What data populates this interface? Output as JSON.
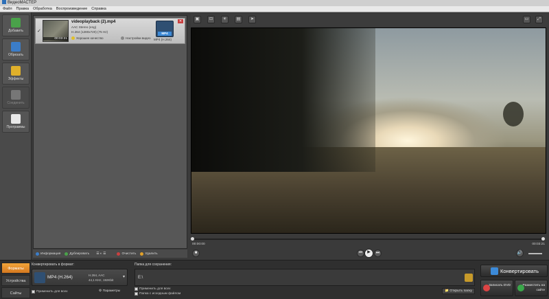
{
  "titlebar": {
    "title": "ВидеоМАСТЕР"
  },
  "menu": {
    "items": [
      "Файл",
      "Правка",
      "Обработка",
      "Воспроизведение",
      "Справка"
    ]
  },
  "leftbar": {
    "items": [
      {
        "label": "Добавить",
        "color": "#4aa24a"
      },
      {
        "label": "Обрезать",
        "color": "#3b7dc9"
      },
      {
        "label": "Эффекты",
        "color": "#e0b02a"
      },
      {
        "label": "Соединить",
        "color": "#777777"
      },
      {
        "label": "Программы",
        "color": "#e8e8e8"
      }
    ]
  },
  "file": {
    "name": "videoplayback (2).mp4",
    "audio": "AAC Stereo (eng)",
    "video": "H.264 (1280x720) (75 Hz)",
    "quality": "Хорошее качество",
    "settings": "Настройки видео",
    "duration": "00:03:21",
    "format_tag": "MP4",
    "format_label": "MP4 (H.264)"
  },
  "listbar": {
    "info": "Информация",
    "dub": "Дублировать",
    "clear": "Очистить",
    "delete": "Удалить"
  },
  "player": {
    "time_start": "00:00:00",
    "time_end": "00:03:21",
    "progress": 0.0,
    "volume": 1.0
  },
  "bottom": {
    "tabs": [
      "Форматы",
      "Устройства",
      "Сайты"
    ],
    "convert_label": "Конвертировать в формат:",
    "format_name": "MP4 (H.264)",
    "format_spec1": "H.264, AAC",
    "format_spec2": "44,1 KHz, 192Kbit",
    "apply_all": "Применить для всех",
    "params": "Параметры",
    "folder_label": "Папка для сохранения:",
    "path": "E:\\",
    "opt_all": "Применить для всех",
    "opt_source": "Папка с исходным файлом",
    "open_folder": "Открыть папку",
    "convert": "Конвертировать",
    "dvd": "Записать DVD",
    "site": "Разместить на сайте"
  }
}
